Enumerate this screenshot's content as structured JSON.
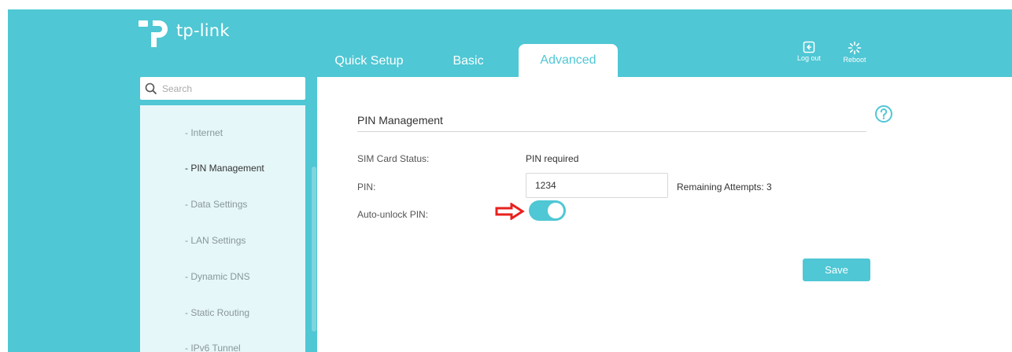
{
  "brand": {
    "name": "tp-link",
    "accent": "#4fc7d4"
  },
  "tabs": [
    {
      "label": "Quick Setup"
    },
    {
      "label": "Basic"
    },
    {
      "label": "Advanced",
      "active": true
    }
  ],
  "toolbar": {
    "logout_label": "Log out",
    "reboot_label": "Reboot"
  },
  "search": {
    "placeholder": "Search"
  },
  "sidebar": {
    "items": [
      {
        "label": "- Internet"
      },
      {
        "label": "- PIN Management",
        "active": true
      },
      {
        "label": "- Data Settings"
      },
      {
        "label": "- LAN Settings"
      },
      {
        "label": "- Dynamic DNS"
      },
      {
        "label": "- Static Routing"
      },
      {
        "label": "- IPv6 Tunnel"
      }
    ]
  },
  "panel": {
    "title": "PIN Management",
    "sim_status_label": "SIM Card Status:",
    "sim_status_value": "PIN required",
    "pin_label": "PIN:",
    "pin_value": "1234",
    "remaining_attempts": "Remaining Attempts: 3",
    "auto_unlock_label": "Auto-unlock PIN:",
    "auto_unlock_on": true,
    "save_label": "Save"
  },
  "annotation": {
    "arrow_color": "#e8211d"
  }
}
